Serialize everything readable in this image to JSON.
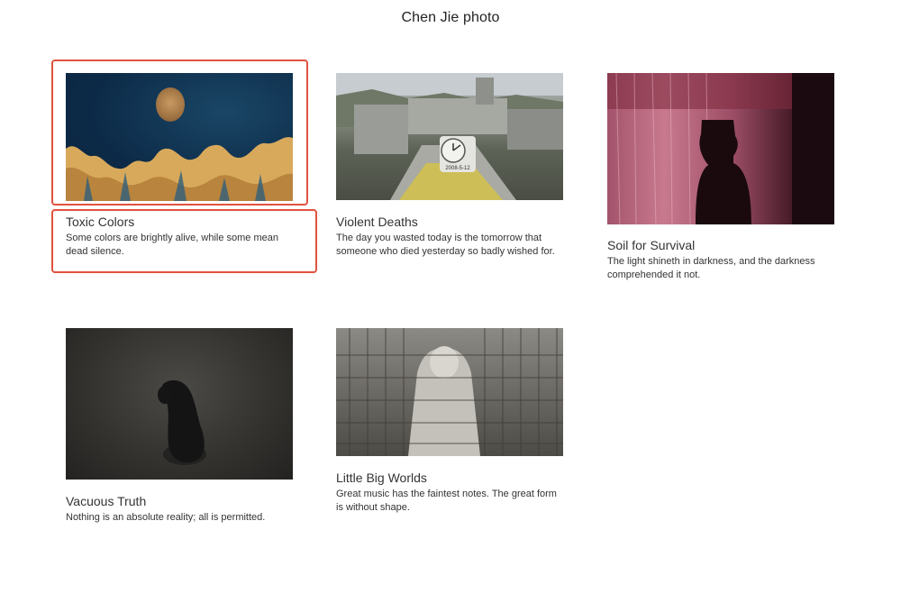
{
  "header": {
    "title": "Chen Jie photo"
  },
  "cards": [
    {
      "title": "Toxic Colors",
      "desc": "Some colors are brightly alive, while some mean dead silence."
    },
    {
      "title": "Violent Deaths",
      "desc": "The day you wasted today is the tomorrow that someone who died yesterday so badly wished for."
    },
    {
      "title": "Soil for Survival",
      "desc": "The light shineth in darkness, and the darkness comprehended it not."
    },
    {
      "title": "Vacuous Truth",
      "desc": "Nothing is an absolute reality; all is permitted."
    },
    {
      "title": "Little Big Worlds",
      "desc": "Great music has the faintest notes. The great form is without shape."
    }
  ],
  "photos": {
    "p2_sign": "2008-5-12"
  },
  "colors": {
    "highlight": "#e0523f"
  }
}
